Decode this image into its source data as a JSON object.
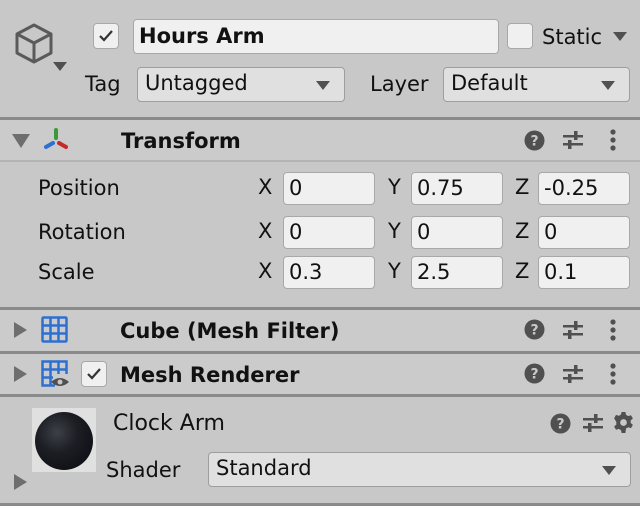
{
  "header": {
    "object_icon": "cube-icon",
    "active": true,
    "name": "Hours Arm",
    "static_label": "Static",
    "static_checked": false,
    "tag_label": "Tag",
    "tag_value": "Untagged",
    "layer_label": "Layer",
    "layer_value": "Default"
  },
  "components": {
    "transform": {
      "title": "Transform",
      "expanded": true,
      "icon": "transform-axes-icon",
      "rows": [
        {
          "label": "Position",
          "x": "0",
          "y": "0.75",
          "z": "-0.25"
        },
        {
          "label": "Rotation",
          "x": "0",
          "y": "0",
          "z": "0"
        },
        {
          "label": "Scale",
          "x": "0.3",
          "y": "2.5",
          "z": "0.1"
        }
      ],
      "axes": {
        "x": "X",
        "y": "Y",
        "z": "Z"
      }
    },
    "mesh_filter": {
      "title": "Cube (Mesh Filter)",
      "expanded": false,
      "icon": "mesh-grid-icon"
    },
    "mesh_renderer": {
      "title": "Mesh Renderer",
      "expanded": false,
      "enabled": true,
      "icon": "mesh-renderer-icon"
    },
    "material": {
      "name": "Clock Arm",
      "shader_label": "Shader",
      "shader_value": "Standard",
      "expanded": false
    }
  },
  "icons": {
    "help": "help-icon",
    "presets": "presets-sliders-icon",
    "more": "kebab-menu-icon",
    "settings": "gear-icon"
  },
  "colors": {
    "background": "#c8c8c8",
    "field": "#f0f0f0",
    "divider": "#8a8a8a",
    "icon": "#505050",
    "mesh_icon_blue": "#2f6fd0",
    "axis_x": "#c62a2a",
    "axis_y": "#3a9a3a",
    "axis_z": "#2f6fd0"
  }
}
